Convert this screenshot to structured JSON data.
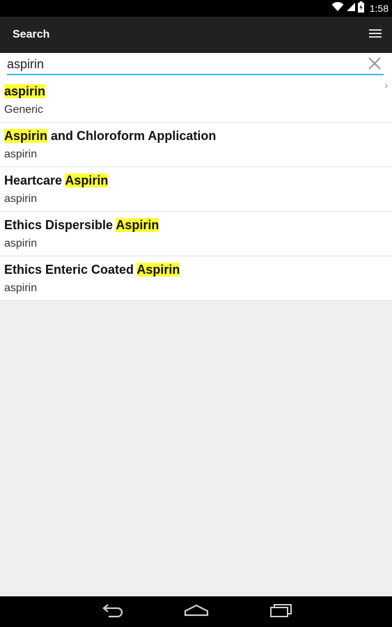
{
  "status_bar": {
    "time": "1:58",
    "icons": [
      "wifi-icon",
      "signal-icon",
      "battery-icon"
    ]
  },
  "action_bar": {
    "title": "Search",
    "menu_icon": "overflow-menu-icon"
  },
  "search": {
    "value": "aspirin",
    "clear_icon": "close-icon",
    "underline_color": "#33b5e5"
  },
  "results": [
    {
      "title_parts": [
        {
          "text": "aspirin",
          "highlight": true
        }
      ],
      "subtitle": "Generic",
      "chevron": "›"
    },
    {
      "title_parts": [
        {
          "text": "Aspirin",
          "highlight": true
        },
        {
          "text": " and Chloroform Application",
          "highlight": false
        }
      ],
      "subtitle": "aspirin"
    },
    {
      "title_parts": [
        {
          "text": "Heartcare ",
          "highlight": false
        },
        {
          "text": "Aspirin",
          "highlight": true
        }
      ],
      "subtitle": "aspirin"
    },
    {
      "title_parts": [
        {
          "text": "Ethics Dispersible ",
          "highlight": false
        },
        {
          "text": "Aspirin",
          "highlight": true
        }
      ],
      "subtitle": "aspirin"
    },
    {
      "title_parts": [
        {
          "text": "Ethics Enteric Coated ",
          "highlight": false
        },
        {
          "text": "Aspirin",
          "highlight": true
        }
      ],
      "subtitle": "aspirin"
    }
  ],
  "nav_bar": {
    "buttons": [
      "back-icon",
      "home-icon",
      "recents-icon"
    ]
  },
  "colors": {
    "highlight": "#ffff33",
    "action_bar": "#212121",
    "background": "#efefef"
  }
}
